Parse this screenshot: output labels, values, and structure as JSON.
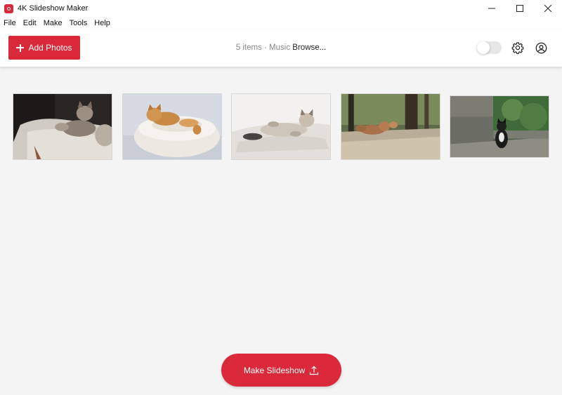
{
  "window": {
    "title": "4K Slideshow Maker"
  },
  "menu": {
    "items": [
      "File",
      "Edit",
      "Make",
      "Tools",
      "Help"
    ]
  },
  "toolbar": {
    "add_label": "Add Photos",
    "status_prefix": "5 items · Music",
    "browse_label": "Browse...",
    "toggle_on": false
  },
  "photos": [
    {
      "subject": "cats resting on a blanket on a chair"
    },
    {
      "subject": "orange cat sleeping in a fluffy bed"
    },
    {
      "subject": "cat lying on its back on a fluffy rug"
    },
    {
      "subject": "cats lying on the ground outdoors"
    },
    {
      "subject": "black and white cat sitting by a wall"
    }
  ],
  "actions": {
    "make_label": "Make Slideshow"
  },
  "colors": {
    "accent": "#d9293a",
    "background": "#f4f4f4"
  }
}
